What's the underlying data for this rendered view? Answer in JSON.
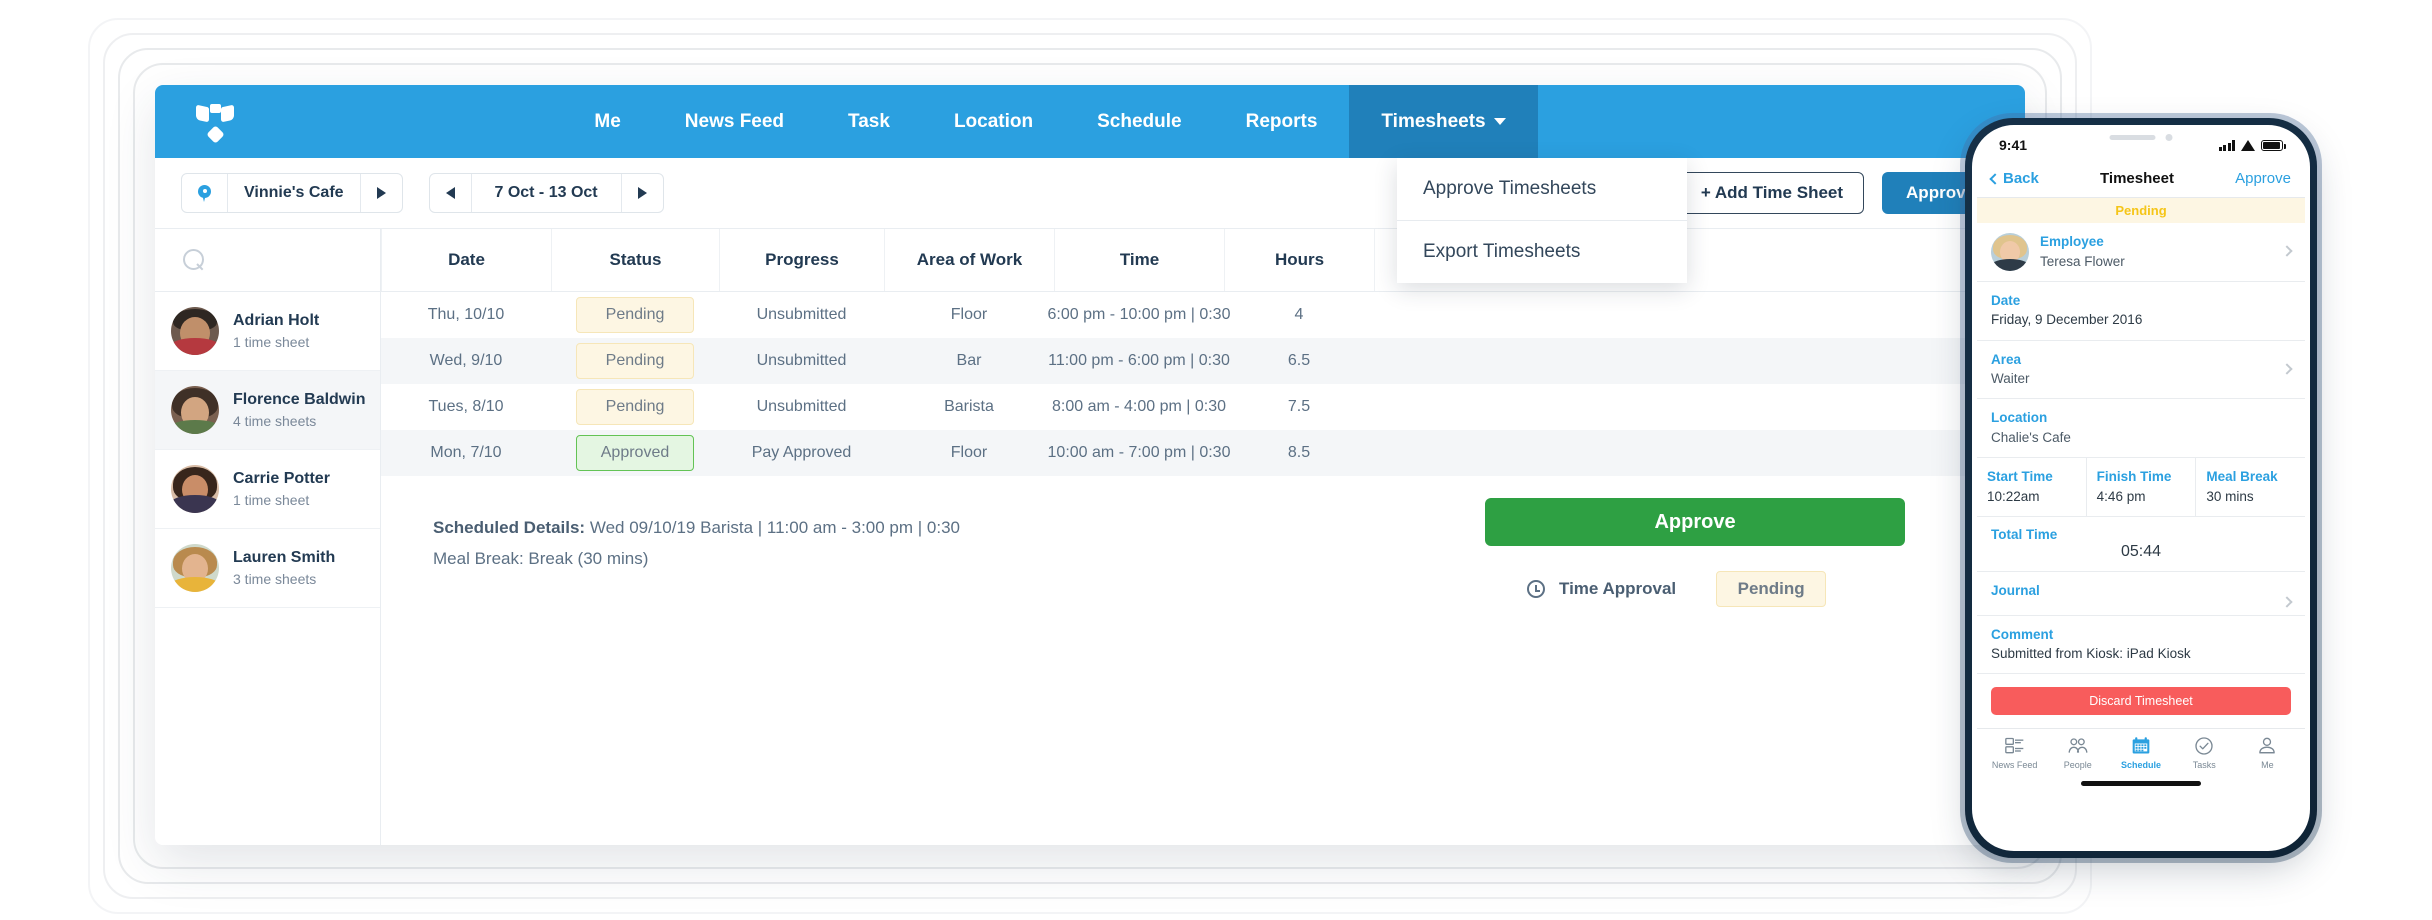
{
  "nav": {
    "logo_name": "deputy-logo",
    "items": [
      {
        "label": "Me",
        "active": false
      },
      {
        "label": "News Feed",
        "active": false
      },
      {
        "label": "Task",
        "active": false
      },
      {
        "label": "Location",
        "active": false
      },
      {
        "label": "Schedule",
        "active": false
      },
      {
        "label": "Reports",
        "active": false
      },
      {
        "label": "Timesheets",
        "active": true,
        "has_caret": true
      }
    ]
  },
  "dropdown": {
    "items": [
      "Approve Timesheets",
      "Export Timesheets"
    ]
  },
  "toolbar": {
    "location": "Vinnie's Cafe",
    "date_range": "7 Oct - 13 Oct",
    "add_timesheet_label": "+ Add Time Sheet",
    "approve_label": "Approve"
  },
  "employees": [
    {
      "name": "Adrian Holt",
      "sheets": "1 time sheet",
      "selected": false
    },
    {
      "name": "Florence Baldwin",
      "sheets": "4 time sheets",
      "selected": true
    },
    {
      "name": "Carrie Potter",
      "sheets": "1 time sheet",
      "selected": false
    },
    {
      "name": "Lauren Smith",
      "sheets": "3 time sheets",
      "selected": false
    }
  ],
  "table": {
    "headers": [
      "Date",
      "Status",
      "Progress",
      "Area of Work",
      "Time",
      "Hours"
    ],
    "rows": [
      {
        "date": "Thu, 10/10",
        "status": "Pending",
        "status_type": "pending",
        "progress": "Unsubmitted",
        "area": "Floor",
        "time": "6:00 pm - 10:00 pm | 0:30",
        "hours": "4"
      },
      {
        "date": "Wed, 9/10",
        "status": "Pending",
        "status_type": "pending",
        "progress": "Unsubmitted",
        "area": "Bar",
        "time": "11:00 pm - 6:00 pm | 0:30",
        "hours": "6.5"
      },
      {
        "date": "Tues, 8/10",
        "status": "Pending",
        "status_type": "pending",
        "progress": "Unsubmitted",
        "area": "Barista",
        "time": "8:00 am - 4:00 pm | 0:30",
        "hours": "7.5"
      },
      {
        "date": "Mon, 7/10",
        "status": "Approved",
        "status_type": "approved",
        "progress": "Pay Approved",
        "area": "Floor",
        "time": "10:00 am - 7:00 pm | 0:30",
        "hours": "8.5"
      }
    ]
  },
  "footer": {
    "scheduled_label": "Scheduled Details:",
    "scheduled_value": "Wed 09/10/19 Barista | 11:00 am - 3:00 pm | 0:30",
    "meal_break": "Meal Break: Break (30 mins)",
    "approve_label": "Approve",
    "time_approval_label": "Time Approval",
    "time_approval_status": "Pending"
  },
  "phone": {
    "status_time": "9:41",
    "back_label": "Back",
    "title": "Timesheet",
    "approve_label": "Approve",
    "pending_banner": "Pending",
    "employee_label": "Employee",
    "employee_name": "Teresa Flower",
    "date_label": "Date",
    "date_value": "Friday, 9 December 2016",
    "area_label": "Area",
    "area_value": "Waiter",
    "location_label": "Location",
    "location_value": "Chalie's Cafe",
    "start_time_label": "Start Time",
    "start_time_value": "10:22am",
    "finish_time_label": "Finish Time",
    "finish_time_value": "4:46 pm",
    "meal_break_label": "Meal Break",
    "meal_break_value": "30 mins",
    "total_time_label": "Total Time",
    "total_time_value": "05:44",
    "journal_label": "Journal",
    "comment_label": "Comment",
    "comment_value": "Submitted from Kiosk: iPad Kiosk",
    "discard_label": "Discard Timesheet",
    "tabs": [
      {
        "label": "News Feed",
        "icon": "news-feed-icon",
        "active": false
      },
      {
        "label": "People",
        "icon": "people-icon",
        "active": false
      },
      {
        "label": "Schedule",
        "icon": "calendar-icon",
        "active": true
      },
      {
        "label": "Tasks",
        "icon": "check-circle-icon",
        "active": false
      },
      {
        "label": "Me",
        "icon": "person-icon",
        "active": false
      }
    ]
  },
  "colors": {
    "brand_blue": "#2ba0e0",
    "active_blue": "#2080ba",
    "green": "#2ea043",
    "red": "#f85c5c",
    "pending_bg": "#fdf6e3",
    "approved_bg": "#e4f6e2"
  }
}
